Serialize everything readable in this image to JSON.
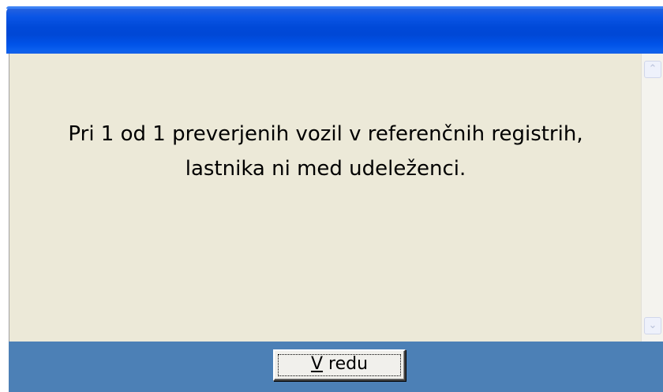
{
  "window": {
    "title": "",
    "title_color": "#0049d8",
    "content_bg": "#ece9d8",
    "footer_bg": "#4c80b6"
  },
  "message": {
    "line1": "Pri 1 od 1 preverjenih vozil v referenčnih registrih,",
    "line2": "lastnika ni med udeleženci."
  },
  "scrollbar": {
    "up_icon": "scroll-up-arrow-icon",
    "down_icon": "scroll-down-arrow-icon",
    "up_glyph": "⌃",
    "down_glyph": "⌄"
  },
  "buttons": {
    "ok": {
      "mnemonic": "V",
      "rest": " redu"
    }
  }
}
